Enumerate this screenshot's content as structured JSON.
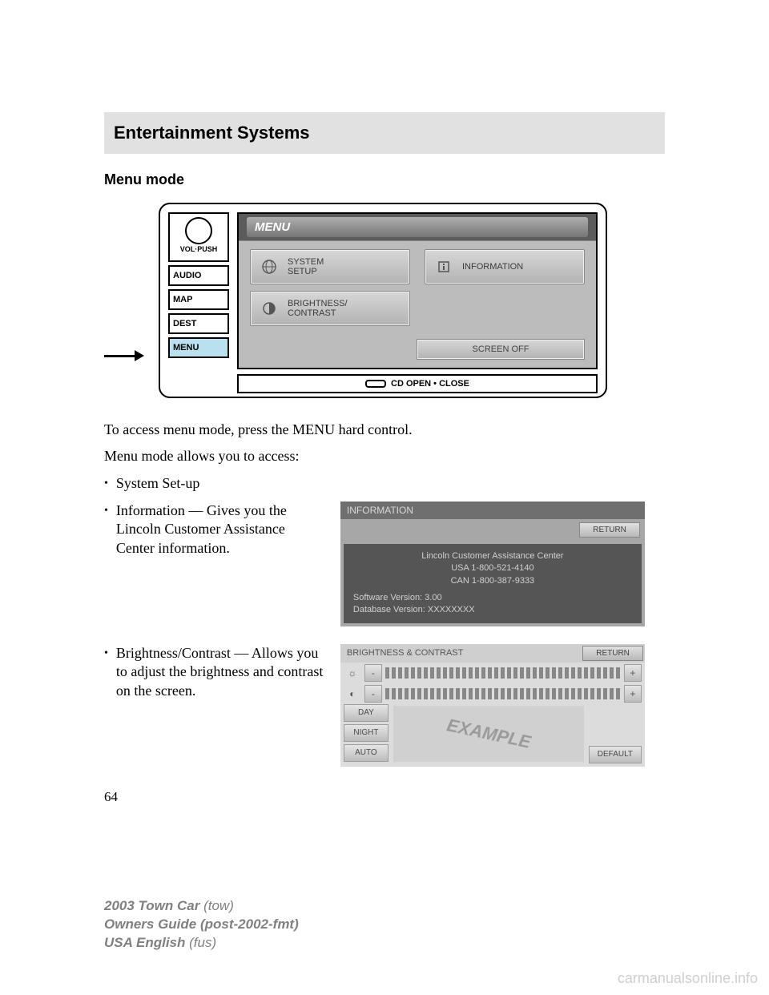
{
  "header": {
    "section_title": "Entertainment Systems"
  },
  "subhead": "Menu mode",
  "device": {
    "knob_label": "VOL·PUSH",
    "buttons": [
      "AUDIO",
      "MAP",
      "DEST",
      "MENU"
    ],
    "active_index": 3,
    "screen_title": "MENU",
    "tiles": [
      {
        "label": "SYSTEM\nSETUP",
        "icon": "globe"
      },
      {
        "label": "INFORMATION",
        "icon": "info"
      },
      {
        "label": "BRIGHTNESS/\nCONTRAST",
        "icon": "contrast"
      }
    ],
    "screen_off": "SCREEN OFF",
    "cd_label": "CD OPEN • CLOSE"
  },
  "body": {
    "p1": "To access menu mode, press the MENU hard control.",
    "p2": "Menu mode allows you to access:",
    "bullets": [
      {
        "text": "System Set-up"
      },
      {
        "text": "Information — Gives you the Lincoln Customer Assistance Center information."
      },
      {
        "text": "Brightness/Contrast — Allows you to adjust the brightness and contrast on the screen."
      }
    ]
  },
  "info_screen": {
    "title": "INFORMATION",
    "return": "RETURN",
    "lines_center": [
      "Lincoln Customer Assistance Center",
      "USA 1-800-521-4140",
      "CAN 1-800-387-9333"
    ],
    "lines_left": [
      "Software Version: 3.00",
      "Database Version: XXXXXXXX"
    ]
  },
  "bc_screen": {
    "title": "BRIGHTNESS & CONTRAST",
    "return": "RETURN",
    "modes": [
      "DAY",
      "NIGHT",
      "AUTO"
    ],
    "minus": "-",
    "plus": "+",
    "default": "DEFAULT",
    "example": "EXAMPLE"
  },
  "page_number": "64",
  "footer": {
    "line1a": "2003 Town Car",
    "line1b": "(tow)",
    "line2a": "Owners Guide (post-2002-fmt)",
    "line3a": "USA English",
    "line3b": "(fus)"
  },
  "watermark": "carmanualsonline.info"
}
